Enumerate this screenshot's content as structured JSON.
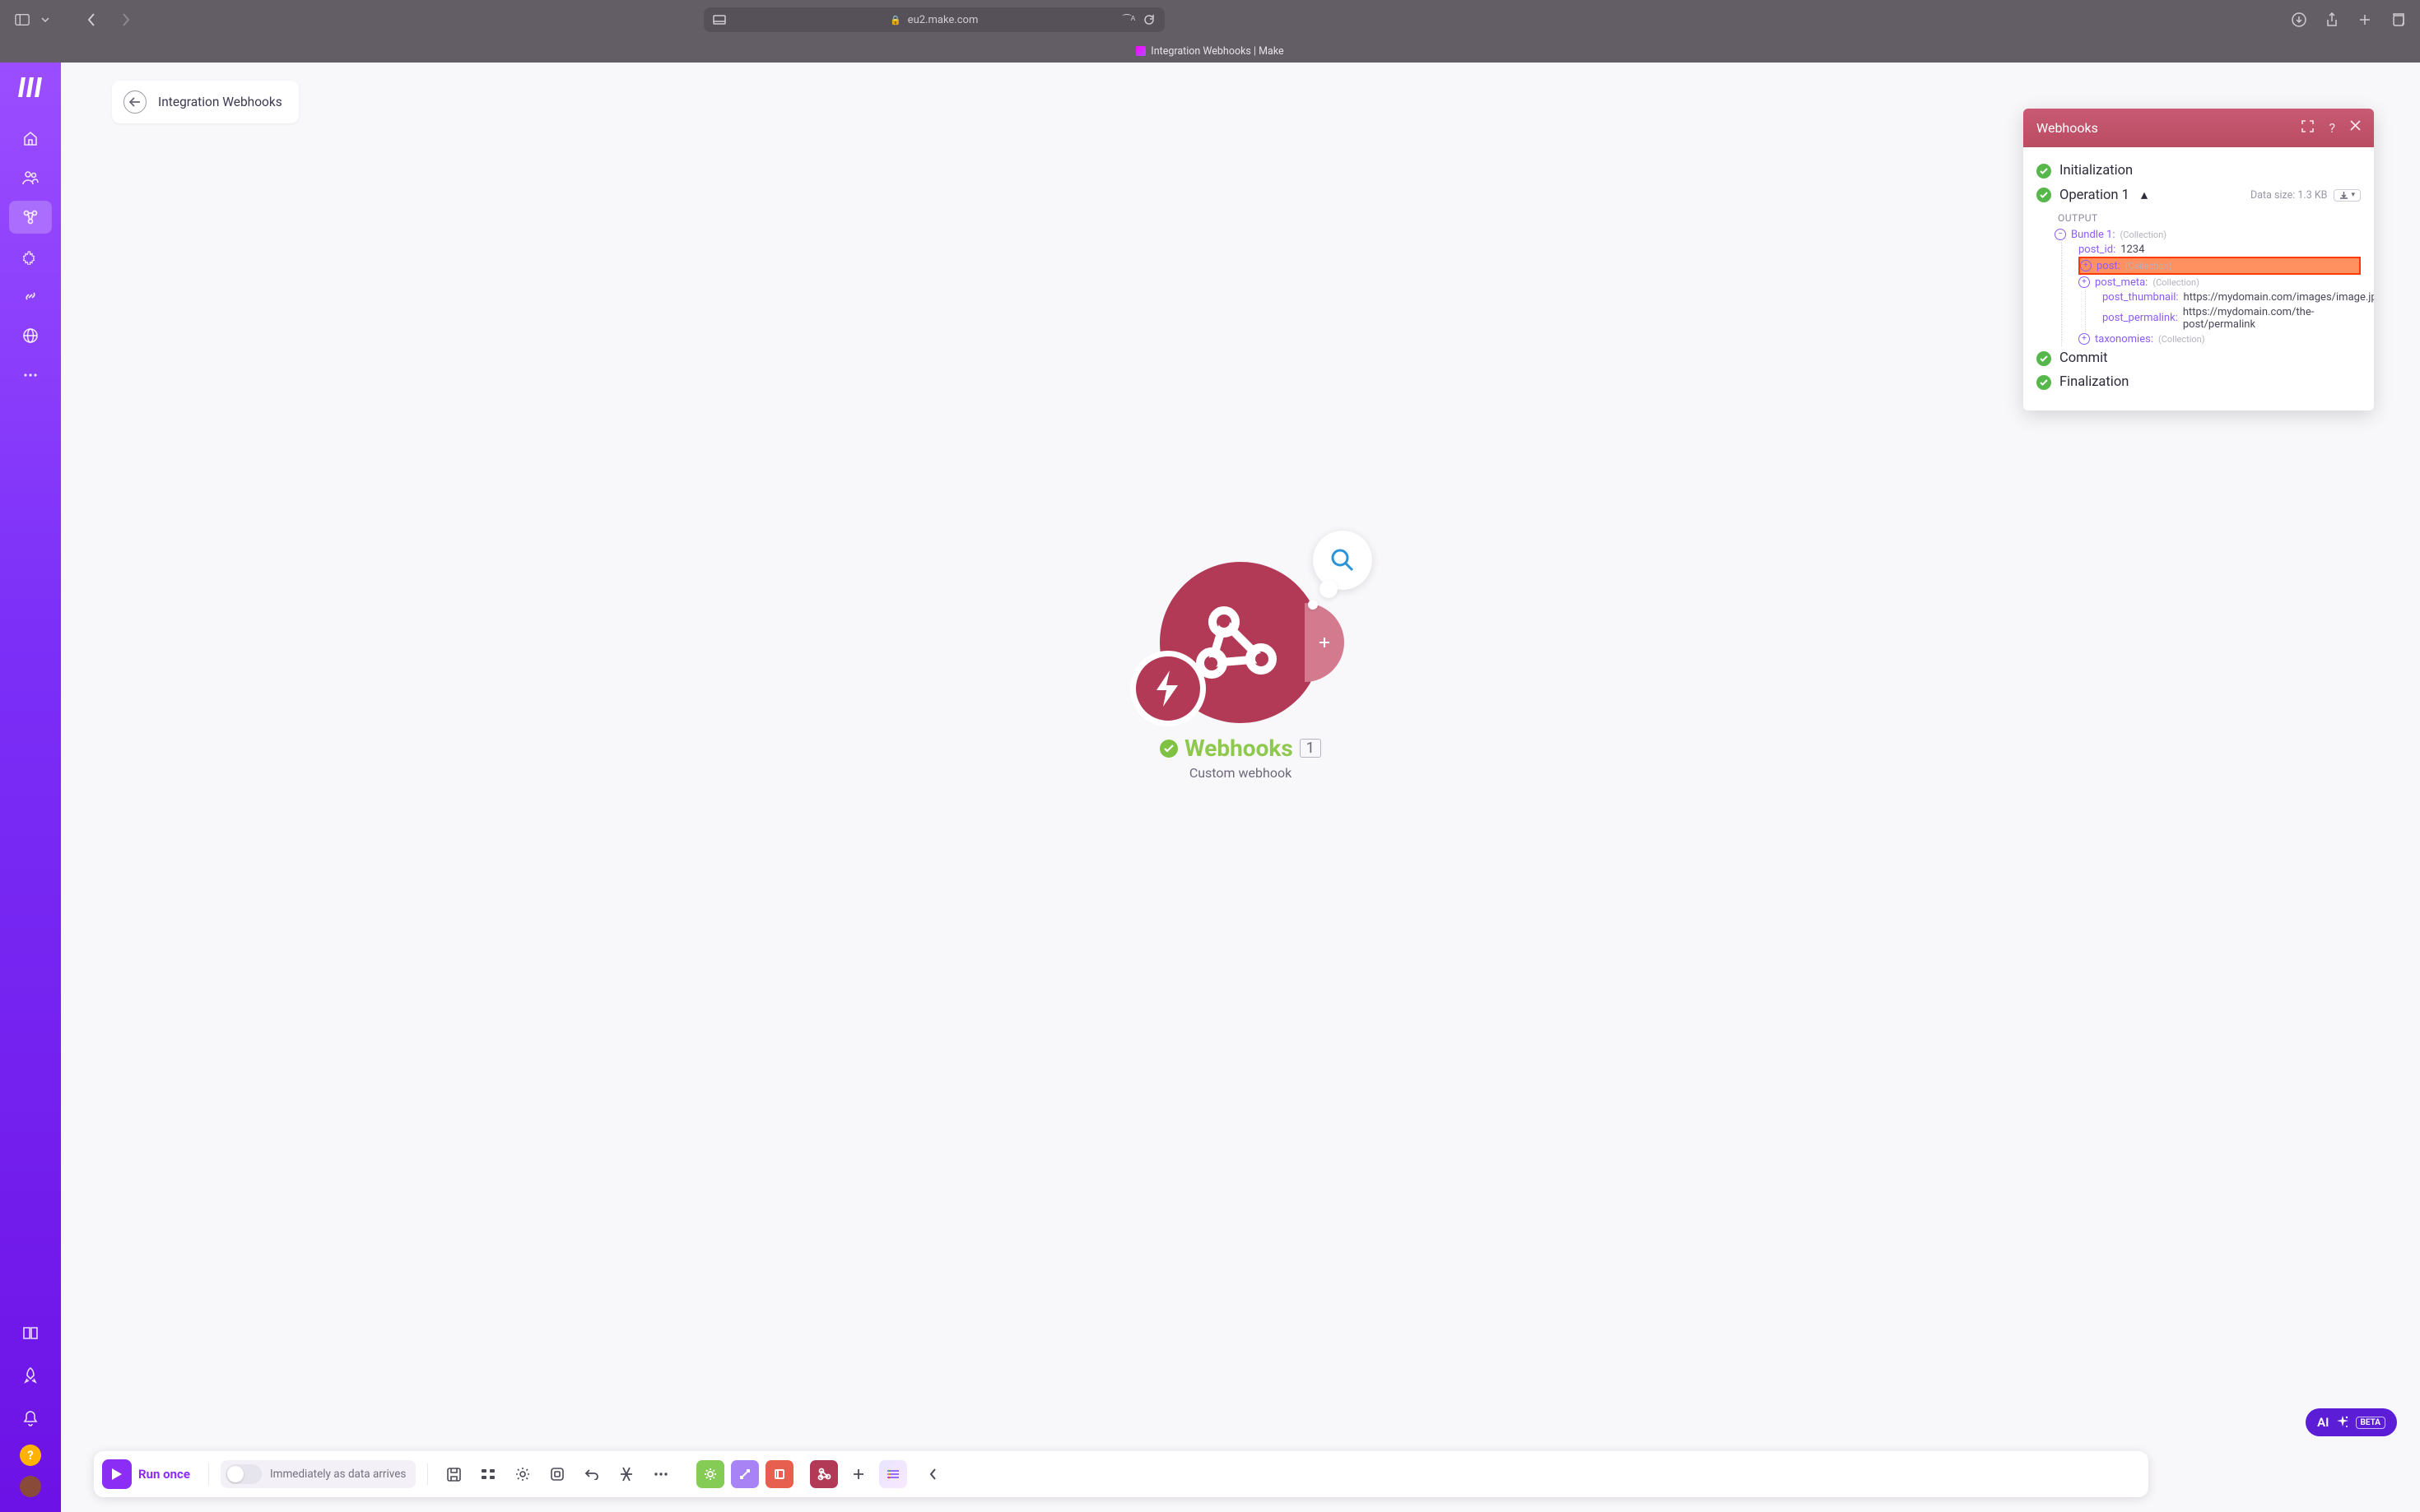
{
  "browser": {
    "url_host": "eu2.make.com",
    "tab_title": "Integration Webhooks | Make"
  },
  "breadcrumb": {
    "title": "Integration Webhooks"
  },
  "node": {
    "title": "Webhooks",
    "count": "1",
    "subtitle": "Custom webhook"
  },
  "panel": {
    "title": "Webhooks",
    "steps": {
      "initialization": "Initialization",
      "operation": "Operation 1",
      "output_label": "OUTPUT",
      "data_size": "Data size: 1.3 KB",
      "commit": "Commit",
      "finalization": "Finalization"
    },
    "bundle_label": "Bundle 1:",
    "collection_tag": "(Collection)",
    "data": {
      "post_id_key": "post_id:",
      "post_id_val": "1234",
      "post_key": "post:",
      "post_meta_key": "post_meta:",
      "post_thumbnail_key": "post_thumbnail:",
      "post_thumbnail_val": "https://mydomain.com/images/image.jpg",
      "post_permalink_key": "post_permalink:",
      "post_permalink_val": "https://mydomain.com/the-post/permalink",
      "taxonomies_key": "taxonomies:"
    }
  },
  "ai": {
    "label": "AI",
    "beta": "BETA"
  },
  "toolbar": {
    "run": "Run once",
    "toggle_label": "Immediately as data arrives"
  }
}
